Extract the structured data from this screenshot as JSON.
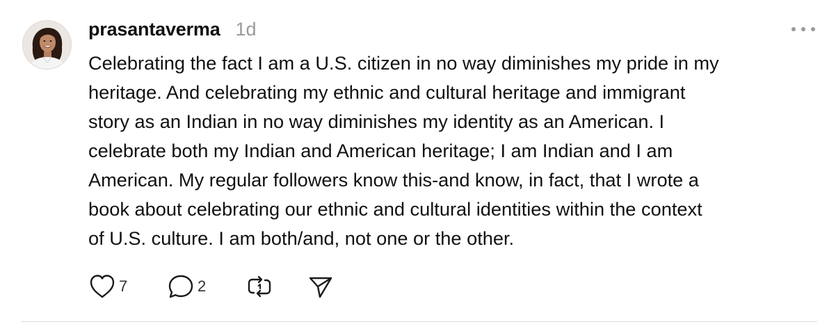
{
  "post": {
    "username": "prasantaverma",
    "timestamp": "1d",
    "body_lines": [
      "Celebrating the fact I am a U.S. citizen in no way diminishes my pride in my",
      "heritage. And celebrating my ethnic and cultural heritage and immigrant",
      "story as an Indian in no way diminishes my identity as an American. I",
      "celebrate both my Indian and American heritage; I am Indian and I am",
      "American. My regular followers know this-and know, in fact, that I wrote a",
      "book about celebrating our ethnic and cultural identities within the context",
      "of U.S. culture. I am both/and, not one or the other."
    ],
    "actions": {
      "like_count": "7",
      "reply_count": "2"
    }
  },
  "icons": {
    "avatar": "profile-photo",
    "more": "more-horizontal-icon",
    "like": "heart-icon",
    "reply": "comment-bubble-icon",
    "repost": "repost-icon",
    "share": "send-icon"
  },
  "colors": {
    "text": "#111111",
    "muted": "#9a9a9a",
    "divider": "#dcdcdc",
    "background": "#ffffff"
  }
}
